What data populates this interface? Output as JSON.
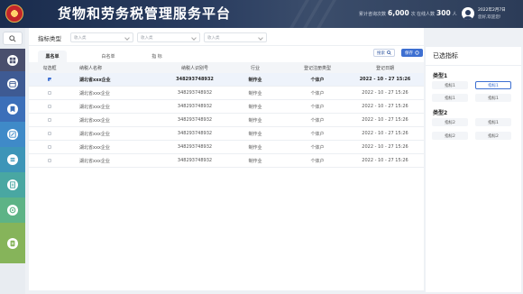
{
  "header": {
    "title": "货物和劳务税管理服务平台",
    "stats": [
      {
        "label": "累计咨询次数",
        "value": "6,000",
        "unit": "次"
      },
      {
        "label": "在线人数",
        "value": "300",
        "unit": "人"
      }
    ],
    "user": {
      "date": "2022年2月7日",
      "greeting": "您好,欢迎您!"
    }
  },
  "sidebar": {
    "items": [
      {
        "icon": "grid-icon",
        "color": "#4a4f6d"
      },
      {
        "icon": "calendar-icon",
        "color": "#3e5a93"
      },
      {
        "icon": "bookmark-icon",
        "color": "#3c6fb9"
      },
      {
        "icon": "edit-icon",
        "color": "#3f8ac8"
      },
      {
        "icon": "list-icon",
        "color": "#3d95b8"
      },
      {
        "icon": "document-icon",
        "color": "#49a7a2"
      },
      {
        "icon": "settings-icon",
        "color": "#5db386"
      },
      {
        "icon": "notes-icon",
        "color": "#86b45a"
      }
    ]
  },
  "filter": {
    "label": "指标类型",
    "inputs": [
      {
        "placeholder": "收入类"
      },
      {
        "placeholder": "收入类"
      },
      {
        "placeholder": "收入类"
      }
    ]
  },
  "tabs": [
    {
      "label": "黑名单",
      "active": true
    },
    {
      "label": "白名单",
      "active": false
    },
    {
      "label": "指    标",
      "active": false
    }
  ],
  "actions": {
    "search_label": "搜索",
    "save_label": "保存"
  },
  "table": {
    "columns": [
      "勾选框",
      "纳税人名称",
      "纳税人识别号",
      "行业",
      "登记注册类型",
      "登记日期"
    ],
    "rows": [
      {
        "checked": true,
        "name": "湖北省xxx企业",
        "tax_id": "348293748932",
        "industry": "制作业",
        "reg_type": "个体户",
        "date": "2022 - 10 - 27  15:26"
      },
      {
        "checked": false,
        "name": "湖北省xxx企业",
        "tax_id": "348293748932",
        "industry": "制作业",
        "reg_type": "个体户",
        "date": "2022 - 10 - 27  15:26"
      },
      {
        "checked": false,
        "name": "湖北省xxx企业",
        "tax_id": "348293748932",
        "industry": "制作业",
        "reg_type": "个体户",
        "date": "2022 - 10 - 27  15:26"
      },
      {
        "checked": false,
        "name": "湖北省xxx企业",
        "tax_id": "348293748932",
        "industry": "制作业",
        "reg_type": "个体户",
        "date": "2022 - 10 - 27  15:26"
      },
      {
        "checked": false,
        "name": "湖北省xxx企业",
        "tax_id": "348293748932",
        "industry": "制作业",
        "reg_type": "个体户",
        "date": "2022 - 10 - 27  15:26"
      },
      {
        "checked": false,
        "name": "湖北省xxx企业",
        "tax_id": "348293748932",
        "industry": "制作业",
        "reg_type": "个体户",
        "date": "2022 - 10 - 27  15:26"
      },
      {
        "checked": false,
        "name": "湖北省xxx企业",
        "tax_id": "348293748932",
        "industry": "制作业",
        "reg_type": "个体户",
        "date": "2022 - 10 - 27  15:26"
      }
    ]
  },
  "right_panel": {
    "title": "已选指标",
    "categories": [
      {
        "label": "类型1",
        "chips": [
          {
            "label": "指标1",
            "selected": false
          },
          {
            "label": "指标1",
            "selected": true
          },
          {
            "label": "指标1",
            "selected": false
          },
          {
            "label": "指标1",
            "selected": false
          }
        ]
      },
      {
        "label": "类型2",
        "chips": [
          {
            "label": "指标2",
            "selected": false
          },
          {
            "label": "指标1",
            "selected": false
          },
          {
            "label": "指标2",
            "selected": false
          },
          {
            "label": "指标2",
            "selected": false
          }
        ]
      }
    ]
  },
  "colors": {
    "accent": "#3d6fd1",
    "header_bg": "#1a2c4d"
  }
}
